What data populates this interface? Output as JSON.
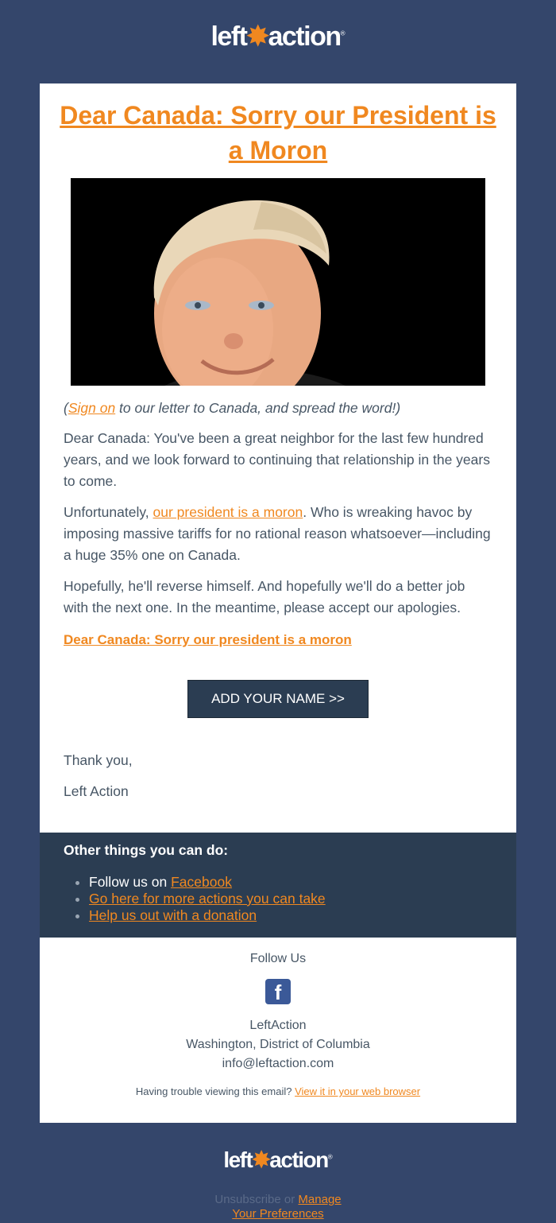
{
  "brand": {
    "logo_left": "left",
    "logo_right": "action",
    "reg": "®"
  },
  "email": {
    "headline": "Dear Canada: Sorry our President is a Moron",
    "intro": {
      "link": "Sign on",
      "text": " to our letter to Canada, and spread the word!)",
      "open_paren": "("
    },
    "para1": "Dear Canada: You've been a great neighbor for the last few hundred years, and we look forward to continuing that relationship in the years to come.",
    "para2": {
      "before": "Unfortunately, ",
      "link": "our president is a moron",
      "after": ". Who is wreaking havoc by imposing massive tariffs for no rational reason whatsoever—including a huge 35% one on Canada."
    },
    "para3": "Hopefully, he'll reverse himself. And hopefully we'll do a better job with the next one. In the meantime, please accept our apologies.",
    "cta_link": "Dear Canada: Sorry our president is a moron ",
    "cta_button": "ADD YOUR NAME >>",
    "thanks": "Thank you,",
    "signature": "Left Action"
  },
  "other": {
    "title": "Other things you can do:",
    "items": [
      {
        "prefix": "Follow us on ",
        "link": "Facebook"
      },
      {
        "prefix": "",
        "link": "Go here for more actions you can take"
      },
      {
        "prefix": "",
        "link": "Help us out with a donation"
      }
    ]
  },
  "footer": {
    "follow": "Follow Us",
    "fb_glyph": "f",
    "org": "LeftAction",
    "address": "Washington, District of Columbia",
    "email": "info@leftaction.com",
    "trouble": "Having trouble viewing this email? ",
    "view_link": "View it in your web browser",
    "unsub": "Unsubscribe",
    "or": " or ",
    "manage": "Manage",
    "manage2": "Your Preferences"
  },
  "colors": {
    "background": "#34466b",
    "accent": "#f08820",
    "dark_panel": "#2b3d52"
  },
  "icons": {
    "hero": "portrait-photo",
    "facebook": "facebook-icon",
    "logo": "leftaction-logo"
  }
}
